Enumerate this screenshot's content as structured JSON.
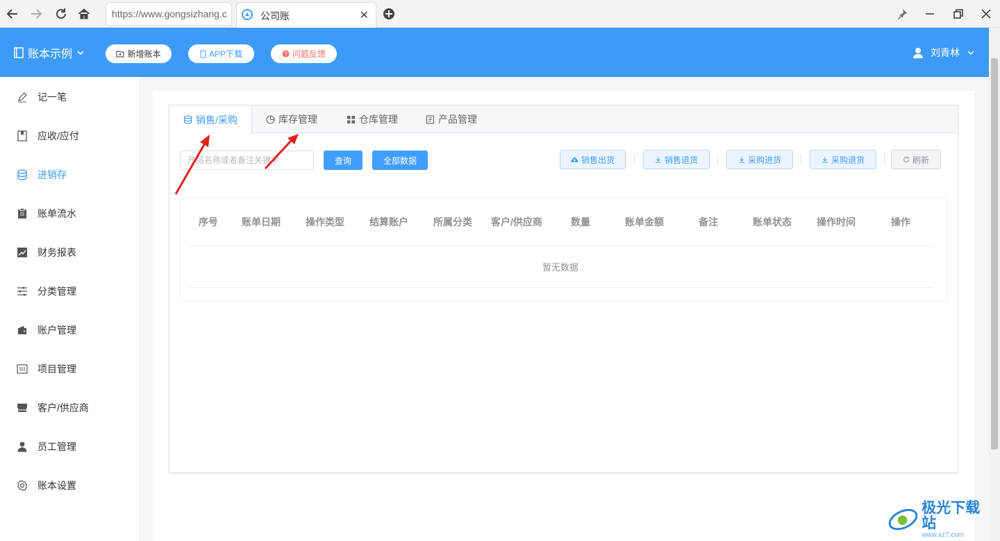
{
  "browser": {
    "url": "https://www.gongsizhang.c",
    "tab_title": "公司账",
    "tab_close": "✕"
  },
  "header": {
    "book_name": "账本示例",
    "buttons": [
      {
        "label": "新增账本",
        "color": "#333333"
      },
      {
        "label": "APP下载",
        "color": "#3d9bf7"
      },
      {
        "label": "问题反馈",
        "color": "#f56c6c"
      }
    ],
    "user_name": "刘青林"
  },
  "sidebar": {
    "items": [
      {
        "label": "记一笔",
        "icon": "pen-icon"
      },
      {
        "label": "应收/应付",
        "icon": "bookmark-book-icon"
      },
      {
        "label": "进销存",
        "icon": "database-icon",
        "active": true
      },
      {
        "label": "账单流水",
        "icon": "clipboard-icon"
      },
      {
        "label": "财务报表",
        "icon": "chart-icon"
      },
      {
        "label": "分类管理",
        "icon": "sliders-icon"
      },
      {
        "label": "账户管理",
        "icon": "wallet-icon"
      },
      {
        "label": "项目管理",
        "icon": "project-icon"
      },
      {
        "label": "客户/供应商",
        "icon": "store-icon"
      },
      {
        "label": "员工管理",
        "icon": "user-icon"
      },
      {
        "label": "账本设置",
        "icon": "gear-icon"
      }
    ]
  },
  "tabs": [
    {
      "label": "销售/采购",
      "icon": "database-icon",
      "active": true
    },
    {
      "label": "库存管理",
      "icon": "pie-icon"
    },
    {
      "label": "仓库管理",
      "icon": "grid-icon"
    },
    {
      "label": "产品管理",
      "icon": "document-icon"
    }
  ],
  "toolbar": {
    "search_placeholder": "产品名称或者备注关键字",
    "query_label": "查询",
    "all_data_label": "全部数据",
    "sales_out_label": "销售出货",
    "sales_return_label": "销售退货",
    "purchase_in_label": "采购进货",
    "purchase_return_label": "采购退货",
    "refresh_label": "刷新"
  },
  "table": {
    "columns": [
      "序号",
      "账单日期",
      "操作类型",
      "结算账户",
      "所属分类",
      "客户/供应商",
      "数量",
      "账单金额",
      "备注",
      "账单状态",
      "操作时间",
      "操作"
    ],
    "empty_text": "暂无数据"
  },
  "watermark": {
    "text": "极光下载站",
    "sub": "www.xz7.com"
  },
  "colors": {
    "primary": "#3d9bf7",
    "annotation_arrow": "#e02020"
  }
}
